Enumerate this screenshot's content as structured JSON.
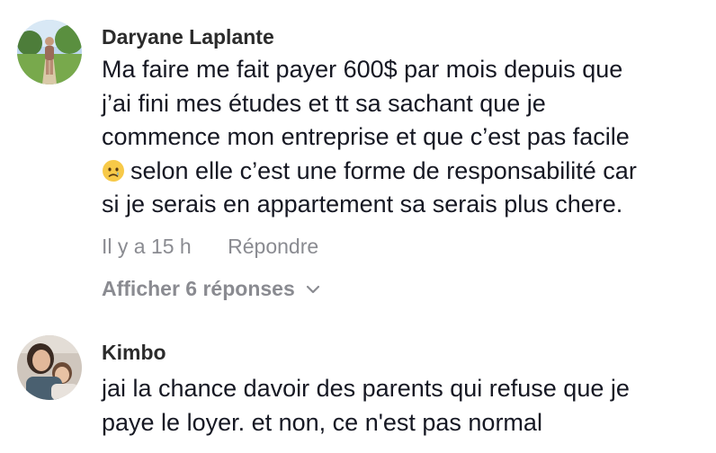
{
  "comments": [
    {
      "author": "Daryane Laplante",
      "lines": [
        "Ma faire me fait payer 600$ par mois depuis que",
        "j’ai fini mes études et tt sa sachant que je",
        "commence mon entreprise et que c’est pas facile",
        "selon elle c’est une forme de responsabilité car",
        "si je serais en appartement sa serais plus chere."
      ],
      "emoji": "crying-face-emoji",
      "time": "Il y a 15 h",
      "reply_label": "Répondre",
      "view_replies_label": "Afficher 6 réponses"
    },
    {
      "author": "Kimbo",
      "lines": [
        "jai la chance davoir des parents qui refuse que je",
        "paye le loyer. et non, ce n'est pas normal"
      ]
    }
  ],
  "colors": {
    "text": "#161823",
    "muted": "#8a8b91",
    "emoji": "#f7c948"
  }
}
